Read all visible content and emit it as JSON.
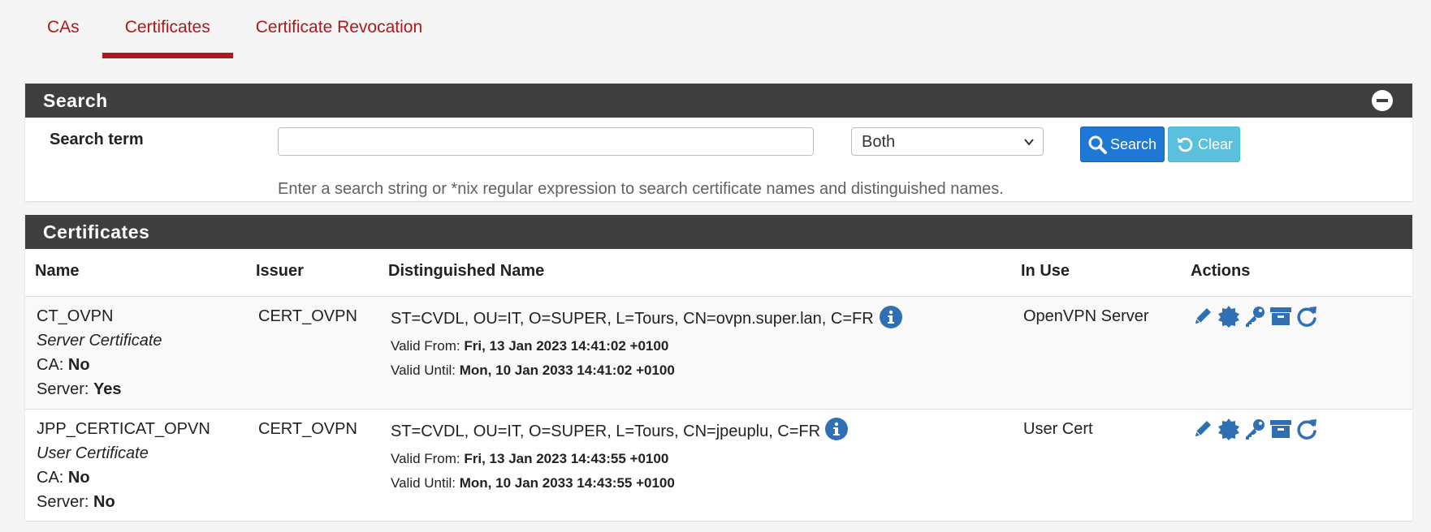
{
  "tabs": [
    {
      "label": "CAs"
    },
    {
      "label": "Certificates"
    },
    {
      "label": "Certificate Revocation"
    }
  ],
  "search_panel": {
    "title": "Search",
    "term_label": "Search term",
    "term_value": "",
    "scope_selected": "Both",
    "search_button": "Search",
    "clear_button": "Clear",
    "help": "Enter a search string or *nix regular expression to search certificate names and distinguished names."
  },
  "certs_panel": {
    "title": "Certificates",
    "columns": [
      "Name",
      "Issuer",
      "Distinguished Name",
      "In Use",
      "Actions"
    ],
    "rows": [
      {
        "name": "CT_OVPN",
        "type": "Server Certificate",
        "ca_label": "CA:",
        "ca": "No",
        "server_label": "Server:",
        "server": "Yes",
        "issuer": "CERT_OVPN",
        "dn": "ST=CVDL, OU=IT, O=SUPER, L=Tours, CN=ovpn.super.lan, C=FR",
        "valid_from_label": "Valid From:",
        "valid_from": "Fri, 13 Jan 2023 14:41:02 +0100",
        "valid_until_label": "Valid Until:",
        "valid_until": "Mon, 10 Jan 2033 14:41:02 +0100",
        "in_use": "OpenVPN Server"
      },
      {
        "name": "JPP_CERTICAT_OPVN",
        "type": "User Certificate",
        "ca_label": "CA:",
        "ca": "No",
        "server_label": "Server:",
        "server": "No",
        "issuer": "CERT_OVPN",
        "dn": "ST=CVDL, OU=IT, O=SUPER, L=Tours, CN=jpeuplu, C=FR",
        "valid_from_label": "Valid From:",
        "valid_from": "Fri, 13 Jan 2023 14:43:55 +0100",
        "valid_until_label": "Valid Until:",
        "valid_until": "Mon, 10 Jan 2033 14:43:55 +0100",
        "in_use": "User Cert"
      }
    ]
  },
  "colors": {
    "accent": "#b0171c",
    "heading_bg": "#3f3f3f",
    "primary_btn": "#1e78d4",
    "info_btn": "#5bc0de",
    "icon": "#2f6fb3"
  }
}
